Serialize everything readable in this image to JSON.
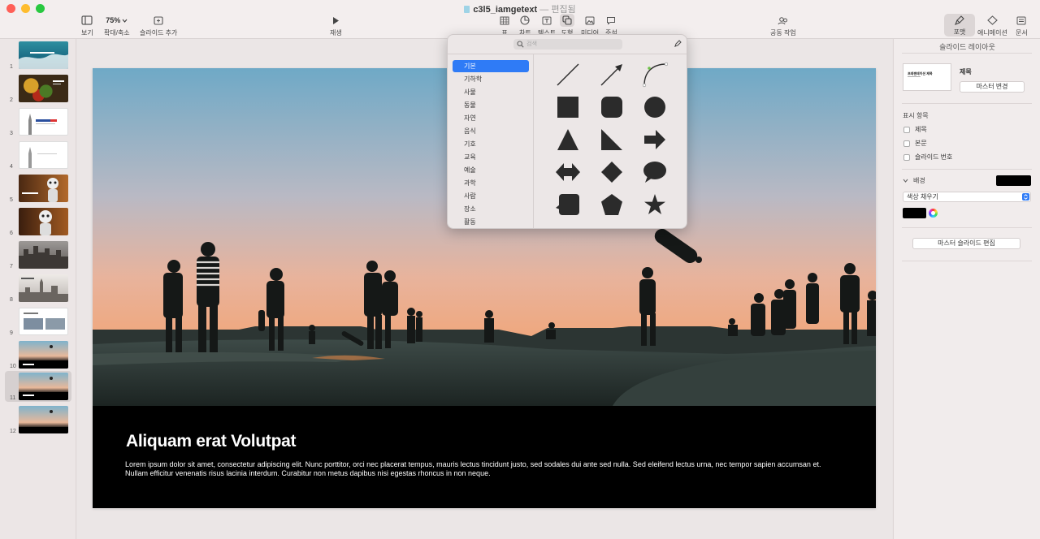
{
  "window": {
    "title": "c3l5_iamgetext",
    "status": "— 편집됨"
  },
  "toolbar": {
    "view_label": "보기",
    "zoom_value": "75%",
    "zoom_label": "확대/축소",
    "add_slide_label": "슬라이드 추가",
    "play_label": "재생",
    "table_label": "표",
    "chart_label": "차트",
    "text_label": "텍스트",
    "shape_label": "도형",
    "media_label": "미디어",
    "comment_label": "주석",
    "collaborate_label": "공동 작업",
    "format_label": "포맷",
    "animate_label": "애니메이션",
    "document_label": "문서"
  },
  "slides": [
    "1",
    "2",
    "3",
    "4",
    "5",
    "6",
    "7",
    "8",
    "9",
    "10",
    "11",
    "12"
  ],
  "selected_slide": "11",
  "slide": {
    "title": "Aliquam erat Volutpat",
    "body": "Lorem ipsum dolor sit amet, consectetur adipiscing elit. Nunc porttitor, orci nec placerat tempus, mauris lectus tincidunt justo, sed sodales dui ante sed nulla. Sed eleifend lectus urna, nec tempor sapien accumsan et. Nullam efficitur venenatis risus lacinia interdum. Curabitur non metus dapibus nisi egestas rhoncus in non neque."
  },
  "shapes_popover": {
    "search_placeholder": "검색",
    "categories": [
      "기본",
      "기하학",
      "사물",
      "동물",
      "자연",
      "음식",
      "기호",
      "교육",
      "예술",
      "과학",
      "사람",
      "장소",
      "활동"
    ],
    "selected_category": "기본",
    "shapes": [
      "line",
      "arrow-line",
      "curve",
      "square",
      "rounded-square",
      "circle",
      "triangle",
      "right-triangle",
      "arrow",
      "double-arrow",
      "diamond",
      "speech-bubble",
      "callout-square",
      "pentagon",
      "star"
    ]
  },
  "inspector": {
    "header": "슬라이드 레이아웃",
    "layout_name": "제목",
    "layout_thumb_text": "프레젠테이션 제목",
    "change_master_button": "마스터 변경",
    "display_section": "표시 항목",
    "checkbox_title": "제목",
    "checkbox_body": "본문",
    "checkbox_slide_number": "슬라이드 번호",
    "background_section": "배경",
    "fill_type": "색상 채우기",
    "background_color": "#000000",
    "edit_master_button": "마스터 슬라이드 편집"
  }
}
